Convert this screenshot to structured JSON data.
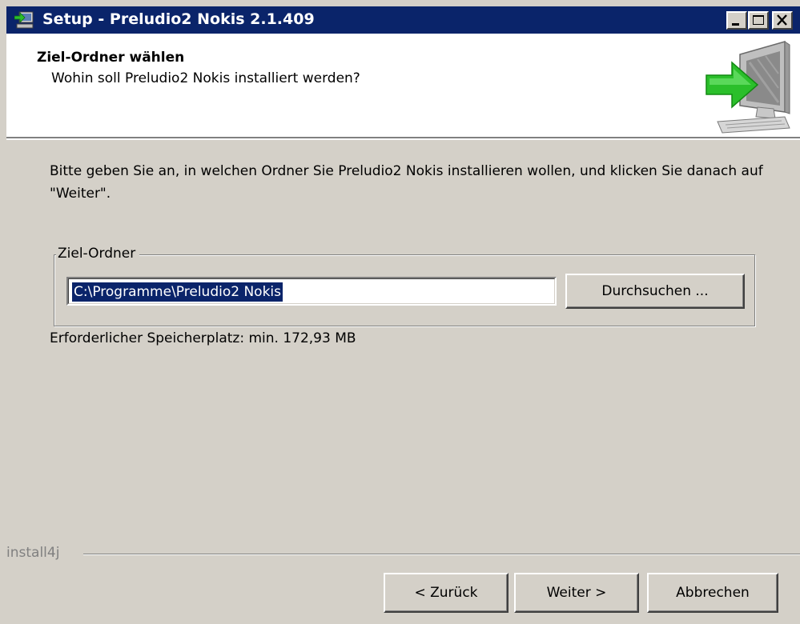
{
  "window": {
    "title": "Setup - Preludio2 Nokis 2.1.409",
    "icon": "installer-icon",
    "controls": [
      "minimize-icon",
      "maximize-icon",
      "close-icon"
    ]
  },
  "header": {
    "title": "Ziel-Ordner wählen",
    "subtitle": "Wohin soll Preludio2 Nokis installiert werden?",
    "graphic": "computer-arrow-icon"
  },
  "content": {
    "instruction": "Bitte geben Sie an, in welchen Ordner Sie Preludio2 Nokis installieren wollen, und klicken Sie danach auf \"Weiter\".",
    "group_label": "Ziel-Ordner",
    "folder_value": "C:\\Programme\\Preludio2 Nokis",
    "browse_label": "Durchsuchen ...",
    "space_info": "Erforderlicher Speicherplatz: min. 172,93 MB"
  },
  "footer": {
    "brand": "install4j",
    "back_label": "< Zurück",
    "next_label": "Weiter >",
    "cancel_label": "Abbrechen"
  },
  "colors": {
    "titlebar": "#0a246a",
    "face": "#d4d0c8",
    "selection": "#0a246a",
    "arrow": "#2bbf2b"
  }
}
